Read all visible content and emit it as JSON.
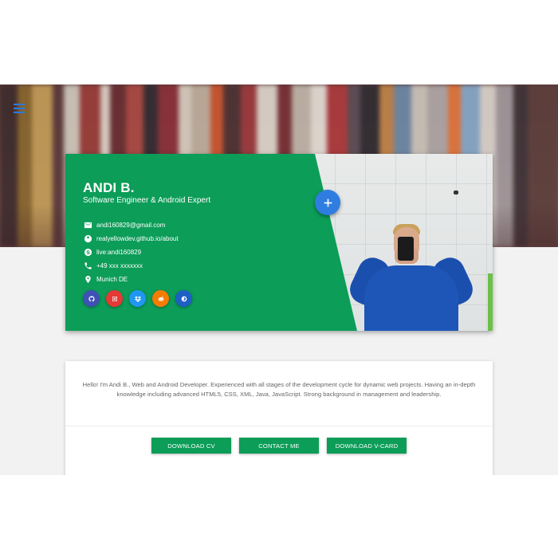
{
  "profile": {
    "name": "ANDI B.",
    "title": "Software Engineer & Android Expert",
    "contacts": [
      {
        "icon": "email-icon",
        "text": "andi160829@gmail.com"
      },
      {
        "icon": "globe-icon",
        "text": "realyellowdev.github.io/about"
      },
      {
        "icon": "skype-icon",
        "text": "live:andi160829"
      },
      {
        "icon": "phone-icon",
        "text": "+49 xxx xxxxxxx"
      },
      {
        "icon": "location-pin-icon",
        "text": "Munich DE"
      }
    ],
    "socials": [
      {
        "icon": "github-icon",
        "color": "#3f51b5"
      },
      {
        "icon": "instagram-icon",
        "color": "#e53935"
      },
      {
        "icon": "dropbox-icon",
        "color": "#2196f3"
      },
      {
        "icon": "reddit-icon",
        "color": "#f57c00"
      },
      {
        "icon": "firefox-icon",
        "color": "#1e5fc4"
      }
    ]
  },
  "fab": {
    "icon": "plus-icon",
    "color": "#2f7de1"
  },
  "menu": {
    "icon": "menu-icon"
  },
  "about": {
    "text": "Hello! I'm Andi B., Web and Android Developer. Experienced with all stages of the development cycle for dynamic web projects. Having an in-depth knowledge including advanced HTML5, CSS, XML, Java, JavaScript. Strong background in management and leadership."
  },
  "actions": {
    "download_cv": "DOWNLOAD CV",
    "contact_me": "CONTACT ME",
    "download_vcard": "DOWNLOAD V-CARD"
  },
  "colors": {
    "accent": "#0c9d58",
    "fab": "#2f7de1"
  }
}
